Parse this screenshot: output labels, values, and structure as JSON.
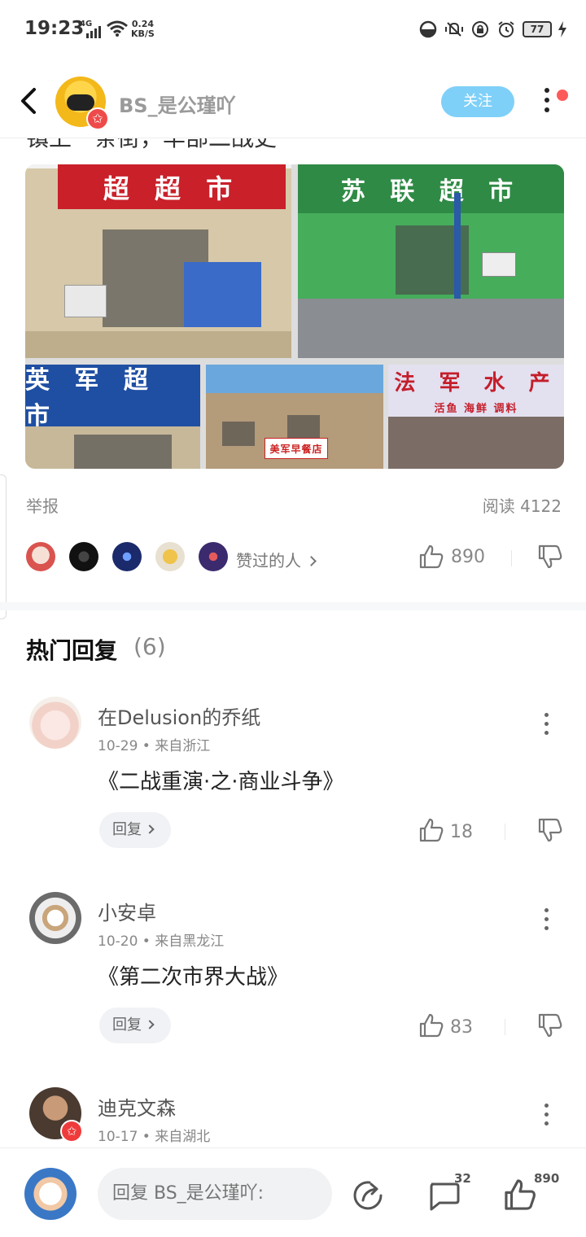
{
  "status_bar": {
    "time": "19:23",
    "network": "4G",
    "speed_value": "0.24",
    "speed_unit": "KB/S",
    "battery": "77"
  },
  "header": {
    "username": "BS_是公瑾吖",
    "follow_label": "关注",
    "avatar_badge": "✩"
  },
  "post": {
    "cut_text": "镇上一条街，华部二战史",
    "images": {
      "t1_sign": "超 超 市",
      "t2_sign": "苏 联 超 市",
      "t3_sign": "英 军 超 市",
      "t4_sign": "美军早餐店",
      "t5_sign": "法 军 水 产",
      "t5_sub": "活鱼 海鲜 调料"
    },
    "report_label": "举报",
    "read_count": "阅读 4122",
    "liked_by_label": "赞过的人",
    "like_count": "890"
  },
  "hot_replies": {
    "title": "热门回复",
    "count": "(6)",
    "comments": [
      {
        "name": "在Delusion的乔纸",
        "meta": "10-29 • 来自浙江",
        "text": "《二战重演·之·商业斗争》",
        "reply_label": "回复",
        "likes": "18"
      },
      {
        "name": "小安卓",
        "meta": "10-20 • 来自黑龙江",
        "text": "《第二次市界大战》",
        "reply_label": "回复",
        "likes": "83"
      },
      {
        "name": "迪克文森",
        "meta": "10-17 • 来自湖北",
        "badge": "✩"
      }
    ]
  },
  "bottom_bar": {
    "reply_placeholder": "回复 BS_是公瑾吖:",
    "comment_count": "32",
    "like_count": "890"
  },
  "colors": {
    "accent_blue": "#7fd0f8",
    "badge_red": "#ef3b3b",
    "notify_dot": "#ff5a5a"
  }
}
